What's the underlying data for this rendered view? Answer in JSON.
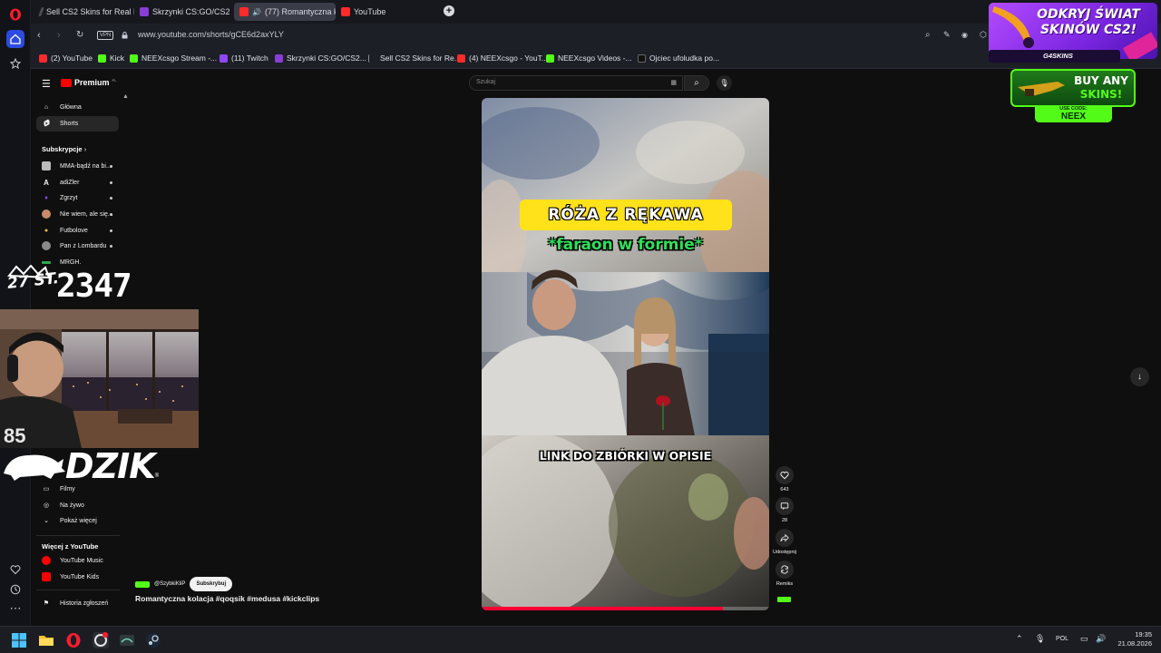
{
  "browser": {
    "tabs": [
      {
        "title": "Sell CS2 Skins for Real Mo",
        "color": "#4a4d56"
      },
      {
        "title": "Skrzynki CS:GO/CS2 | G4S",
        "color": "#8a3cd6"
      },
      {
        "title": "(77) Romantyczna kola",
        "color": "#ff2a2a"
      },
      {
        "title": "YouTube",
        "color": "#ff2a2a"
      }
    ],
    "vpn_label": "VPN",
    "url": "www.youtube.com/shorts/gCE6d2axYLY",
    "bookmarks": [
      {
        "label": "(2) YouTube",
        "color": "#ff2a2a"
      },
      {
        "label": "Kick",
        "color": "#53fc18"
      },
      {
        "label": "NEEXcsgo Stream -...",
        "color": "#53fc18"
      },
      {
        "label": "(11) Twitch",
        "color": "#9146ff"
      },
      {
        "label": "Skrzynki CS:GO/CS2...",
        "color": "#8a3cd6"
      },
      {
        "label": "Sell CS2 Skins for Re...",
        "color": "#4a4d56"
      },
      {
        "label": "(4) NEEXcsgo - YouT...",
        "color": "#ff2a2a"
      },
      {
        "label": "NEEXcsgo Videos -...",
        "color": "#53fc18"
      },
      {
        "label": "Ojciec ufoludka po...",
        "color": "#111111"
      }
    ]
  },
  "youtube": {
    "logo": "Premium",
    "logo_sup": "PL",
    "search_placeholder": "Szukaj",
    "nav": [
      {
        "label": "Główna",
        "icon": "home-icon"
      },
      {
        "label": "Shorts",
        "icon": "shorts-icon"
      }
    ],
    "subs_title": "Subskrypcje",
    "subscriptions": [
      {
        "label": "MMA-bądź na bi...",
        "color": "#bbbbbb"
      },
      {
        "label": "adiZler",
        "color": "#ffffff"
      },
      {
        "label": "Zgrzyt",
        "color": "#9146ff"
      },
      {
        "label": "Nie wiem, ale się...",
        "color": "#c98a6a"
      },
      {
        "label": "Futbolove",
        "color": "#f2c12e"
      },
      {
        "label": "Pan z Lombardu",
        "color": "#8a8a8a"
      },
      {
        "label": "MRGH.",
        "color": "#2ea84a"
      }
    ],
    "you_items": [
      {
        "label": "Filmy",
        "icon": "video-icon"
      },
      {
        "label": "Na żywo",
        "icon": "live-icon"
      },
      {
        "label": "Pokaż więcej",
        "icon": "chevron-down-icon"
      }
    ],
    "more_title": "Więcej z YouTube",
    "more_items": [
      {
        "label": "YouTube Music",
        "color": "#ff0000"
      },
      {
        "label": "YouTube Kids",
        "color": "#ff0000"
      }
    ],
    "report_history": "Historia zgłoszeń"
  },
  "short": {
    "caption_top": "RÓŻA Z RĘKAWA",
    "caption_sub": "*faraon w formie*",
    "caption_bottom": "LINK DO ZBIÓRKI W OPISIE",
    "channel": "@SzybkiKliP",
    "subscribe": "Subskrybuj",
    "title": "Romantyczna kolacja #qoqsik #medusa #kickclips",
    "likes": "643",
    "comments": "28",
    "share_label": "Udostępnij",
    "remix_label": "Remiks",
    "progress": 0.84
  },
  "overlay": {
    "counter_badge": "27 ST.",
    "counter": "2347",
    "brand": "DZIK",
    "ad_top_line1": "ODKRYJ ŚWIAT",
    "ad_top_line2": "SKINÓW CS2!",
    "ad_top_brand": "G4SKINS",
    "ad_bottom_line1": "BUY ANY",
    "ad_bottom_line2": "SKINS!",
    "ad_code_label": "USE CODE:",
    "ad_code": "NEEX"
  },
  "taskbar": {
    "lang": "POL",
    "time": "19:35",
    "date": "21.08.2026"
  }
}
